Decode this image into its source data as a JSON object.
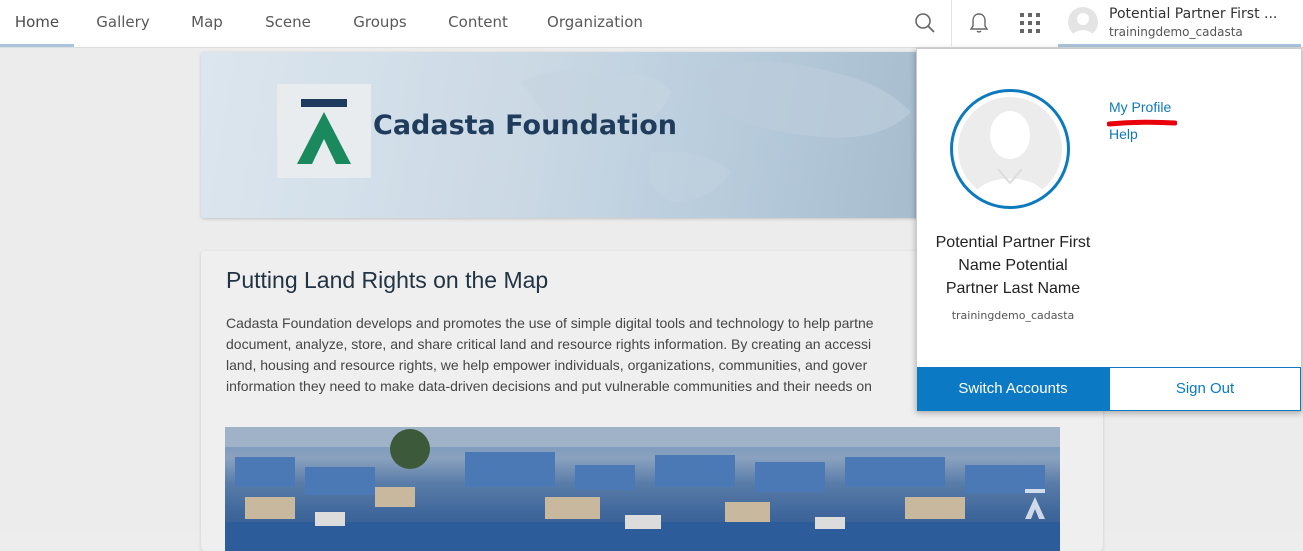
{
  "nav": {
    "items": [
      {
        "label": "Home",
        "active": true
      },
      {
        "label": "Gallery"
      },
      {
        "label": "Map"
      },
      {
        "label": "Scene"
      },
      {
        "label": "Groups"
      },
      {
        "label": "Content"
      },
      {
        "label": "Organization"
      }
    ],
    "icons": [
      "search-icon",
      "bell-icon",
      "app-launcher-icon"
    ]
  },
  "user": {
    "display_name": "Potential Partner First ...",
    "username": "trainingdemo_cadasta"
  },
  "banner": {
    "title": "Cadasta Foundation"
  },
  "card": {
    "title": "Putting Land Rights on the Map",
    "body_lines": [
      "Cadasta Foundation develops and promotes the use of simple digital tools and technology to help partne",
      "document, analyze, store, and share critical land and resource rights information. By creating an accessi",
      "land, housing and resource rights, we help empower individuals, organizations, communities, and gover",
      "information they need to make data-driven decisions and put vulnerable communities and their needs on"
    ]
  },
  "dropdown": {
    "full_name_lines": [
      "Potential Partner First",
      "Name Potential",
      "Partner Last Name"
    ],
    "username": "trainingdemo_cadasta",
    "links": {
      "profile": "My Profile",
      "help": "Help"
    },
    "switch_label": "Switch Accounts",
    "signout_label": "Sign Out",
    "accent_color": "#0b79c3",
    "annotation_color": "#e8000b"
  }
}
